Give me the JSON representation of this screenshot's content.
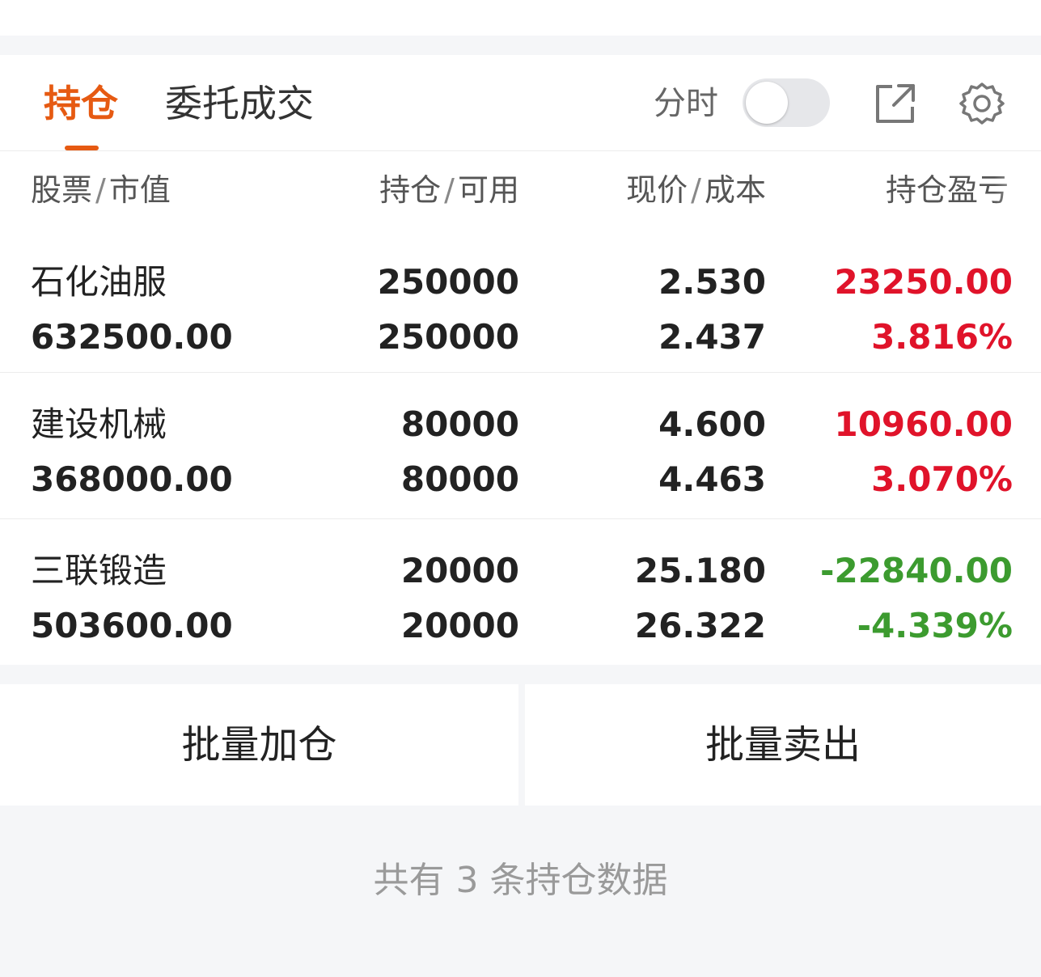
{
  "tabs": {
    "positions": "持仓",
    "orders": "委托成交"
  },
  "toolbar": {
    "timeshare_label": "分时",
    "timeshare_on": false
  },
  "columns": {
    "col1_a": "股票",
    "col1_b": "市值",
    "col2_a": "持仓",
    "col2_b": "可用",
    "col3_a": "现价",
    "col3_b": "成本",
    "col4": "持仓盈亏",
    "separator": "/"
  },
  "holdings": [
    {
      "name": "石化油服",
      "market_value": "632500.00",
      "position": "250000",
      "available": "250000",
      "price": "2.530",
      "cost": "2.437",
      "pl": "23250.00",
      "pl_pct": "3.816%",
      "direction": "up"
    },
    {
      "name": "建设机械",
      "market_value": "368000.00",
      "position": "80000",
      "available": "80000",
      "price": "4.600",
      "cost": "4.463",
      "pl": "10960.00",
      "pl_pct": "3.070%",
      "direction": "up"
    },
    {
      "name": "三联锻造",
      "market_value": "503600.00",
      "position": "20000",
      "available": "20000",
      "price": "25.180",
      "cost": "26.322",
      "pl": "-22840.00",
      "pl_pct": "-4.339%",
      "direction": "down"
    }
  ],
  "actions": {
    "batch_add": "批量加仓",
    "batch_sell": "批量卖出"
  },
  "footer": {
    "summary": "共有 3 条持仓数据"
  },
  "colors": {
    "accent": "#e65a12",
    "gain": "#e0132a",
    "loss": "#3c9b2f"
  },
  "icons": {
    "share": "share-external-icon",
    "settings": "gear-icon"
  }
}
